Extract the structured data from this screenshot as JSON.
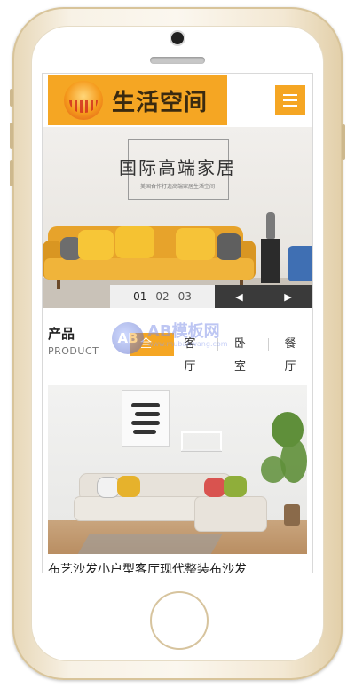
{
  "header": {
    "logo_text": "生活空间",
    "menu_icon": "hamburger-menu-icon"
  },
  "banner": {
    "title": "国际高端家居",
    "subtitle": "美国合作打造高端家居生活空间",
    "slides": [
      "01",
      "02",
      "03"
    ],
    "active_slide": "01",
    "prev_label": "◀",
    "next_label": "▶"
  },
  "product_section": {
    "title": "产品",
    "subtitle": "PRODUCT",
    "tabs": [
      "全部",
      "客厅",
      "卧室",
      "餐厅"
    ],
    "active_tab": "全部"
  },
  "watermark": {
    "logo": "AB",
    "text": "AB模板网",
    "url": "www.mubanwang.com"
  },
  "product": {
    "caption": "布艺沙发小户型客厅现代整装布沙发"
  },
  "colors": {
    "accent": "#f5a623",
    "slider_bg": "#3a3a3a"
  }
}
